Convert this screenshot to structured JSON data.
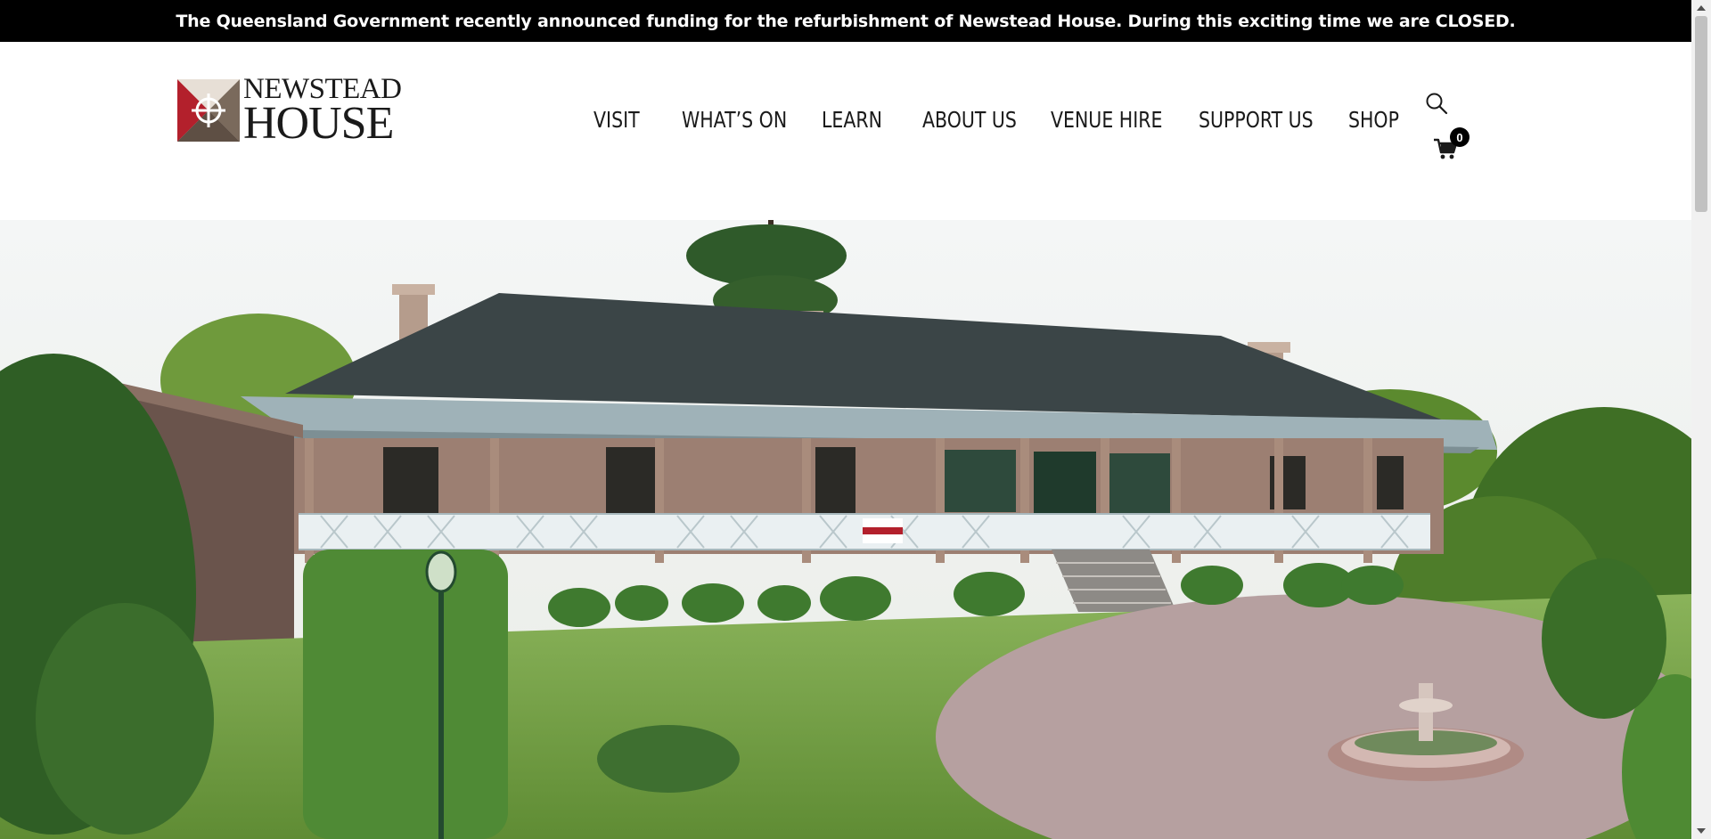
{
  "announcement": {
    "text": "The Queensland Government recently announced funding for the refurbishment of Newstead House.  During this exciting time we are CLOSED."
  },
  "logo": {
    "line1": "NEWSTEAD",
    "line2": "HOUSE",
    "colors": {
      "red": "#b3202c",
      "brown": "#7a6a5c",
      "dark": "#1a1a1a"
    }
  },
  "nav": {
    "items": [
      "VISIT",
      "WHAT’S ON",
      "LEARN",
      "ABOUT US",
      "VENUE HIRE",
      "SUPPORT US",
      "SHOP"
    ]
  },
  "header_icons": {
    "search": "search-icon",
    "cart": "cart-icon",
    "cart_count": "0"
  },
  "hero": {
    "image": "newstead-house-exterior",
    "colors": {
      "sky": "#eef1f2",
      "roof": "#3b4547",
      "veranda": "#a9b9be",
      "wall": "#9c7f72",
      "lawn": "#7fa24a",
      "paving": "#b9a3a3"
    }
  }
}
